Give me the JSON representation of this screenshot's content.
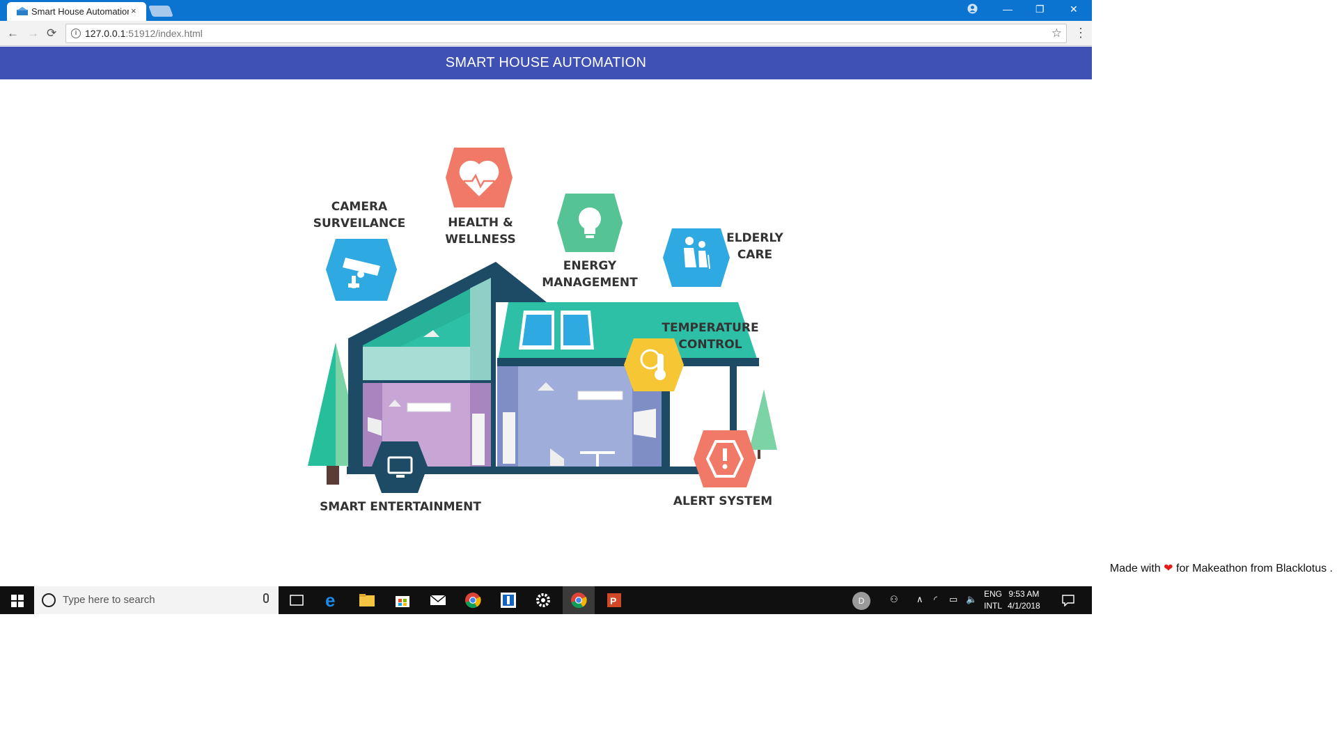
{
  "browser": {
    "tab_title": "Smart House Automation",
    "tab_close": "×",
    "url_host": "127.0.0.1",
    "url_path": ":51912/index.html",
    "back": "←",
    "forward": "→",
    "reload": "⟳",
    "star": "☆",
    "menu": "⋮",
    "win_min": "—",
    "win_max": "❐",
    "win_close": "✕",
    "icons": [
      "tab-favicon",
      "new-tab-icon",
      "profile-icon",
      "info-icon"
    ]
  },
  "page": {
    "header_title": "SMART HOUSE AUTOMATION",
    "labels": {
      "camera": [
        "CAMERA",
        "SURVEILANCE"
      ],
      "health": [
        "HEALTH &",
        "WELLNESS"
      ],
      "energy": [
        "ENERGY",
        "MANAGEMENT"
      ],
      "elderly": [
        "ELDERLY",
        "CARE"
      ],
      "temperature": [
        "TEMPERATURE",
        "CONTROL"
      ],
      "entertainment": "SMART ENTERTAINMENT",
      "alert": "ALERT SYSTEM"
    },
    "colors": {
      "header": "#3f51b5",
      "health": "#f07a67",
      "energy": "#55c393",
      "camera": "#2ea9e2",
      "elderly": "#2ea9e2",
      "temperature": "#f6c634",
      "alert": "#f07a67",
      "entertainment": "#1d4b65"
    },
    "footer": {
      "prefix": "Made with",
      "heart": "❤",
      "suffix": "for Makeathon from Blacklotus ."
    }
  },
  "taskbar": {
    "search_placeholder": "Type here to search",
    "apps": [
      "start-icon",
      "task-view-icon",
      "edge-icon",
      "file-explorer-icon",
      "store-icon",
      "mail-icon",
      "chrome-icon",
      "app-icon",
      "settings-icon",
      "chrome-active-icon",
      "powerpoint-icon"
    ],
    "user_initial": "D",
    "lang_top": "ENG",
    "lang_bottom": "INTL",
    "time": "9:53 AM",
    "date": "4/1/2018"
  }
}
